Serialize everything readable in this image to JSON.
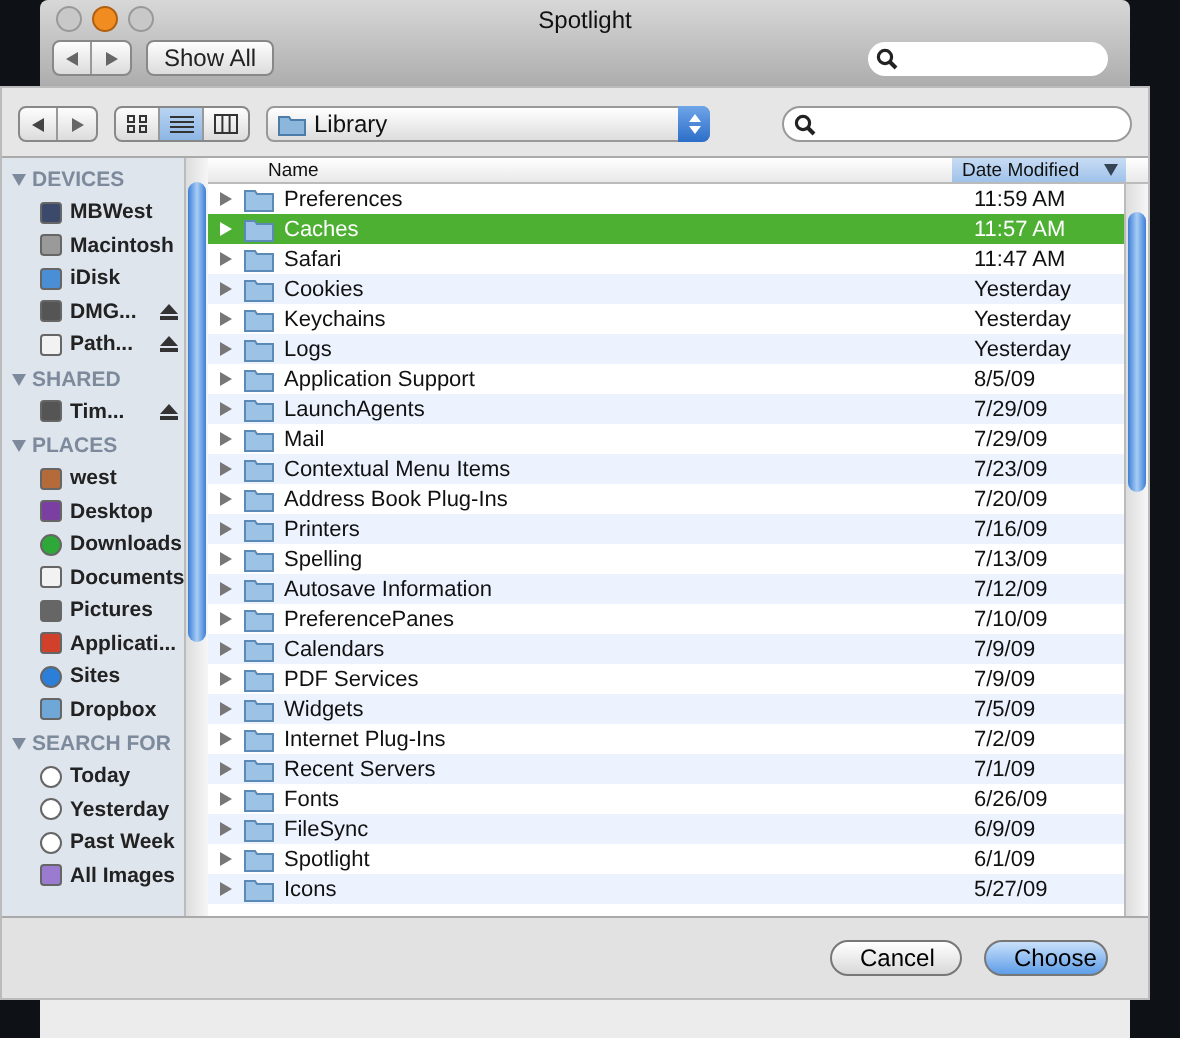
{
  "window": {
    "title": "Spotlight",
    "show_all": "Show All"
  },
  "sheet": {
    "view_modes": [
      {
        "kind": "icons",
        "selected": false
      },
      {
        "kind": "list",
        "selected": true
      },
      {
        "kind": "columns",
        "selected": false
      }
    ],
    "location": "Library",
    "sidebar": [
      {
        "title": "DEVICES",
        "items": [
          {
            "label": "MBWest",
            "kind": "computer",
            "eject": false
          },
          {
            "label": "Macintosh",
            "kind": "disk",
            "eject": false
          },
          {
            "label": "iDisk",
            "kind": "idisk",
            "eject": false
          },
          {
            "label": "DMG...",
            "kind": "drive",
            "eject": true
          },
          {
            "label": "Path...",
            "kind": "page",
            "eject": true
          }
        ]
      },
      {
        "title": "SHARED",
        "items": [
          {
            "label": "Tim...",
            "kind": "drive",
            "eject": true
          }
        ]
      },
      {
        "title": "PLACES",
        "items": [
          {
            "label": "west",
            "kind": "home",
            "eject": false
          },
          {
            "label": "Desktop",
            "kind": "desktop",
            "eject": false
          },
          {
            "label": "Downloads",
            "kind": "download",
            "eject": false
          },
          {
            "label": "Documents",
            "kind": "page",
            "eject": false
          },
          {
            "label": "Pictures",
            "kind": "camera",
            "eject": false
          },
          {
            "label": "Applicati...",
            "kind": "apps",
            "eject": false
          },
          {
            "label": "Sites",
            "kind": "globe",
            "eject": false
          },
          {
            "label": "Dropbox",
            "kind": "folder",
            "eject": false
          }
        ]
      },
      {
        "title": "SEARCH FOR",
        "items": [
          {
            "label": "Today",
            "kind": "clock",
            "eject": false
          },
          {
            "label": "Yesterday",
            "kind": "clock",
            "eject": false
          },
          {
            "label": "Past Week",
            "kind": "clock",
            "eject": false
          },
          {
            "label": "All Images",
            "kind": "purple",
            "eject": false
          }
        ]
      }
    ],
    "columns": [
      {
        "label": "Name",
        "sorted": false
      },
      {
        "label": "Date Modified",
        "sorted": true
      }
    ],
    "rows": [
      {
        "name": "Preferences",
        "date": "11:59 AM",
        "selected": false
      },
      {
        "name": "Caches",
        "date": "11:57 AM",
        "selected": true
      },
      {
        "name": "Safari",
        "date": "11:47 AM",
        "selected": false
      },
      {
        "name": "Cookies",
        "date": "Yesterday",
        "selected": false
      },
      {
        "name": "Keychains",
        "date": "Yesterday",
        "selected": false
      },
      {
        "name": "Logs",
        "date": "Yesterday",
        "selected": false
      },
      {
        "name": "Application Support",
        "date": "8/5/09",
        "selected": false
      },
      {
        "name": "LaunchAgents",
        "date": "7/29/09",
        "selected": false
      },
      {
        "name": "Mail",
        "date": "7/29/09",
        "selected": false
      },
      {
        "name": "Contextual Menu Items",
        "date": "7/23/09",
        "selected": false
      },
      {
        "name": "Address Book Plug-Ins",
        "date": "7/20/09",
        "selected": false
      },
      {
        "name": "Printers",
        "date": "7/16/09",
        "selected": false
      },
      {
        "name": "Spelling",
        "date": "7/13/09",
        "selected": false
      },
      {
        "name": "Autosave Information",
        "date": "7/12/09",
        "selected": false
      },
      {
        "name": "PreferencePanes",
        "date": "7/10/09",
        "selected": false
      },
      {
        "name": "Calendars",
        "date": "7/9/09",
        "selected": false
      },
      {
        "name": "PDF Services",
        "date": "7/9/09",
        "selected": false
      },
      {
        "name": "Widgets",
        "date": "7/5/09",
        "selected": false
      },
      {
        "name": "Internet Plug-Ins",
        "date": "7/2/09",
        "selected": false
      },
      {
        "name": "Recent Servers",
        "date": "7/1/09",
        "selected": false
      },
      {
        "name": "Fonts",
        "date": "6/26/09",
        "selected": false
      },
      {
        "name": "FileSync",
        "date": "6/9/09",
        "selected": false
      },
      {
        "name": "Spotlight",
        "date": "6/1/09",
        "selected": false
      },
      {
        "name": "Icons",
        "date": "5/27/09",
        "selected": false
      }
    ],
    "buttons": [
      {
        "label": "Cancel",
        "kind": "plain"
      },
      {
        "label": "Choose",
        "kind": "default"
      }
    ]
  }
}
